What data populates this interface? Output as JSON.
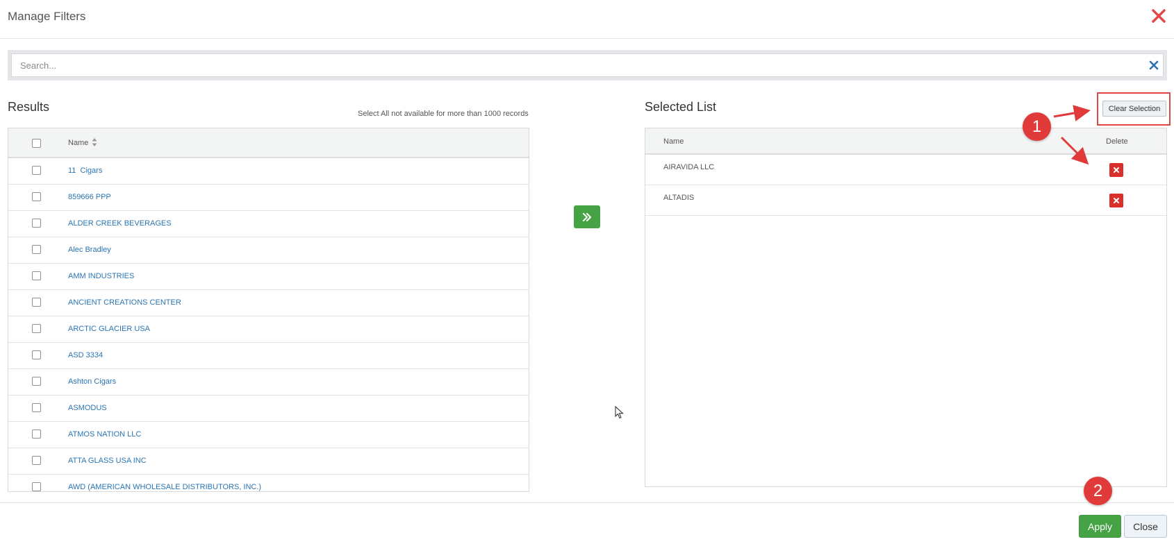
{
  "header": {
    "title": "Manage Filters"
  },
  "search": {
    "placeholder": "Search..."
  },
  "results": {
    "title": "Results",
    "note": "Select All not available for more than 1000 records",
    "column_name": "Name",
    "rows": [
      "11  Cigars",
      "859666 PPP",
      "ALDER CREEK BEVERAGES",
      "Alec Bradley",
      "AMM INDUSTRIES",
      "ANCIENT CREATIONS CENTER",
      "ARCTIC GLACIER USA",
      "ASD 3334",
      "Ashton Cigars",
      "ASMODUS",
      "ATMOS NATION LLC",
      "ATTA GLASS USA INC",
      "AWD (AMERICAN WHOLESALE DISTRIBUTORS, INC.)"
    ]
  },
  "selected": {
    "title": "Selected List",
    "clear_label": "Clear Selection",
    "column_name": "Name",
    "column_delete": "Delete",
    "rows": [
      "AIRAVIDA LLC",
      "ALTADIS"
    ]
  },
  "footer": {
    "apply_label": "Apply",
    "close_label": "Close"
  },
  "annotations": {
    "badge_1": "1",
    "badge_2": "2"
  },
  "colors": {
    "primary_green": "#46a345",
    "danger_red": "#d9302c",
    "link_blue": "#2a74b3",
    "annotation_red": "#e03a3a"
  }
}
